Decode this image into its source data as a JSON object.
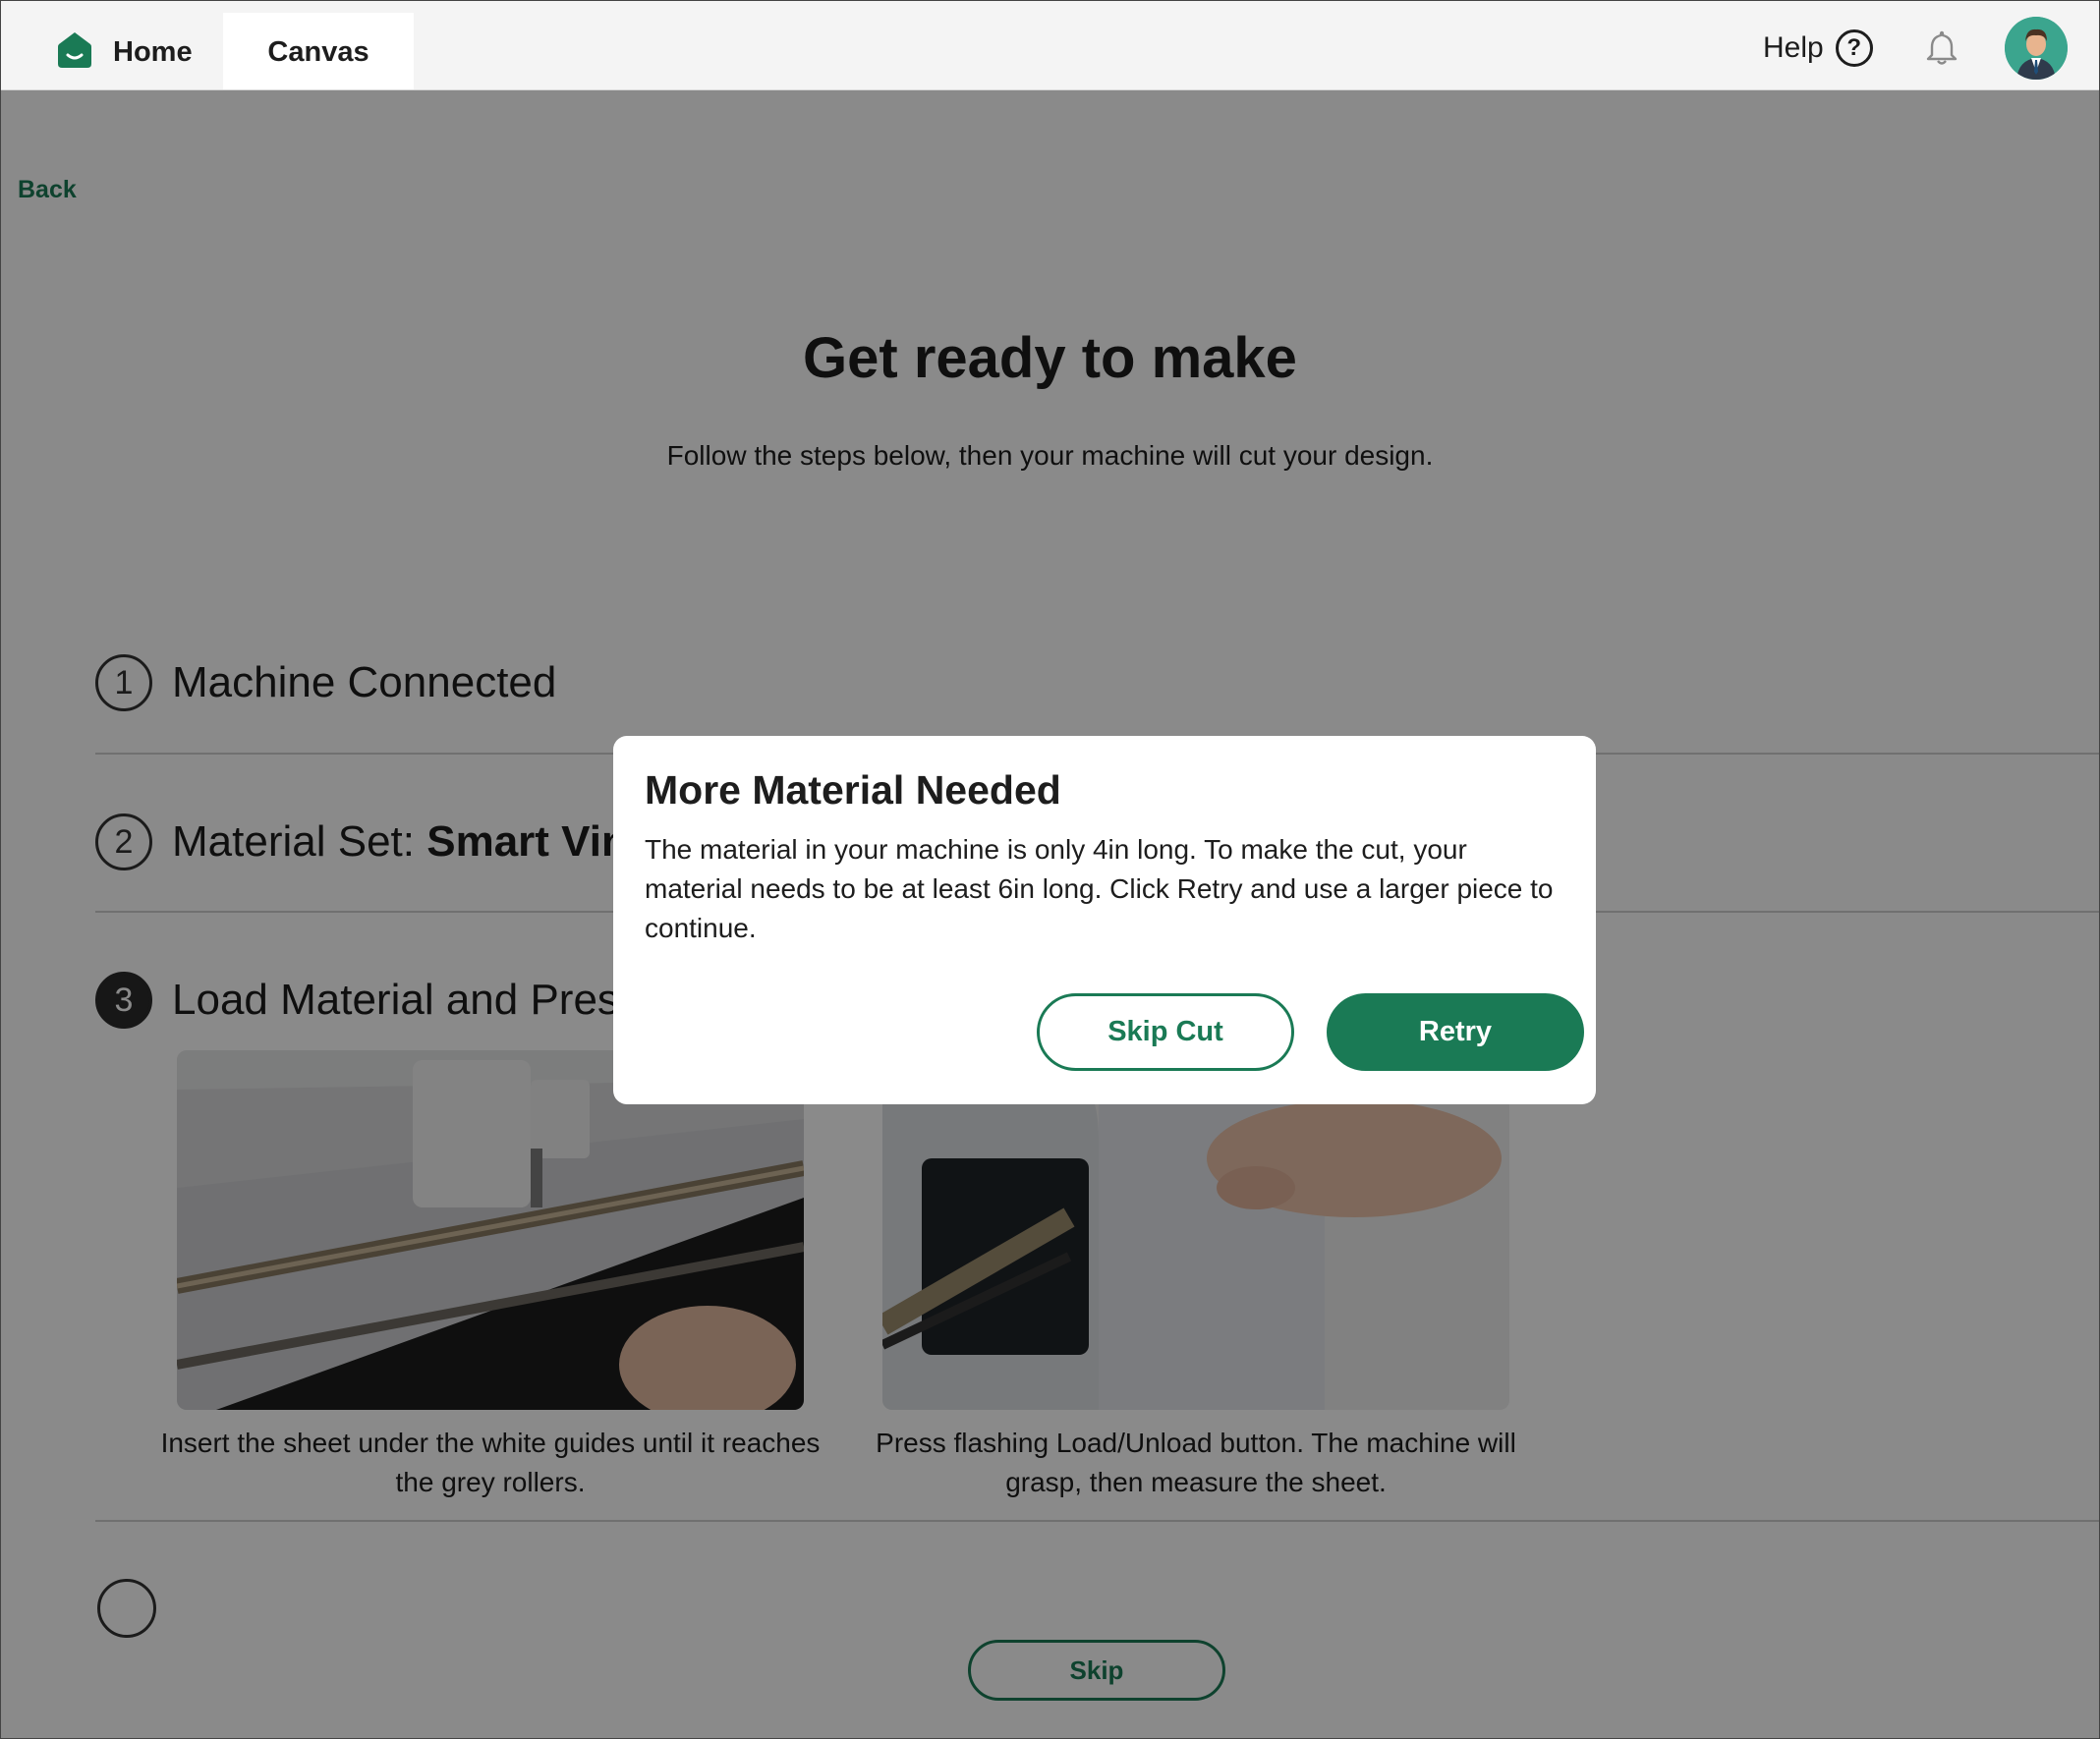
{
  "header": {
    "home_label": "Home",
    "canvas_label": "Canvas",
    "help_label": "Help",
    "help_icon_glyph": "?",
    "brand_color": "#1a7a55"
  },
  "page": {
    "back_label": "Back",
    "title": "Get ready to make",
    "subtitle": "Follow the steps below, then your machine will cut your design."
  },
  "steps": [
    {
      "number": "1",
      "title": "Machine Connected"
    },
    {
      "number": "2",
      "title_prefix": "Material Set: ",
      "title_bold": "Smart Vinyl"
    },
    {
      "number": "3",
      "title": "Load Material and Press Go"
    }
  ],
  "load_step": {
    "captions": [
      "Insert the sheet under the white guides until it reaches the grey rollers.",
      "Press flashing Load/Unload button. The machine will grasp, then measure the sheet."
    ]
  },
  "footer": {
    "skip_label": "Skip"
  },
  "dialog": {
    "title": "More Material Needed",
    "body": "The material in your machine is only 4in long. To make the cut, your material needs to be at least 6in long. Click Retry and use a larger piece to continue.",
    "skip_cut_label": "Skip Cut",
    "retry_label": "Retry"
  },
  "icons": [
    "home-icon",
    "help-icon",
    "bell-icon",
    "avatar"
  ]
}
